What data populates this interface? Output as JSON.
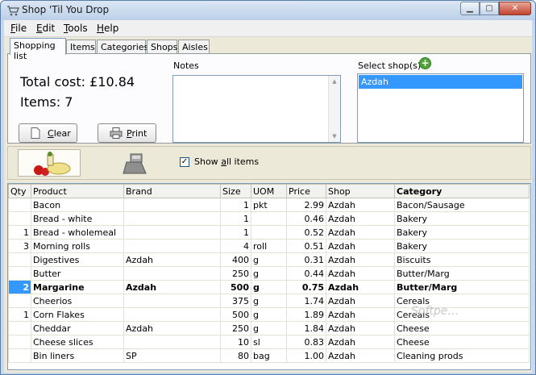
{
  "window": {
    "title": "Shop 'Til You Drop"
  },
  "menu": {
    "file": "File",
    "edit": "Edit",
    "tools": "Tools",
    "help": "Help"
  },
  "tabs": [
    "Shopping list",
    "Items",
    "Categories",
    "Shops",
    "Aisles"
  ],
  "summary": {
    "total": "Total cost: £10.84",
    "items": "Items: 7"
  },
  "buttons": {
    "clear": "Clear",
    "print": "Print"
  },
  "notes": {
    "label": "Notes",
    "value": ""
  },
  "shops": {
    "label": "Select shop(s)",
    "selected": "Azdah"
  },
  "toolbar": {
    "show_all_label": "Show all items",
    "show_all_checked": true
  },
  "grid": {
    "columns": [
      "Qty",
      "Product",
      "Brand",
      "Size",
      "UOM",
      "Price",
      "Shop",
      "Category"
    ],
    "rows": [
      [
        "",
        "Bacon",
        "",
        "1",
        "pkt",
        "2.99",
        "Azdah",
        "Bacon/Sausage"
      ],
      [
        "",
        "Bread - white",
        "",
        "1",
        "",
        "0.46",
        "Azdah",
        "Bakery"
      ],
      [
        "1",
        "Bread - wholemeal",
        "",
        "1",
        "",
        "0.52",
        "Azdah",
        "Bakery"
      ],
      [
        "3",
        "Morning rolls",
        "",
        "4",
        "roll",
        "0.51",
        "Azdah",
        "Bakery"
      ],
      [
        "",
        "Digestives",
        "Azdah",
        "400",
        "g",
        "0.31",
        "Azdah",
        "Biscuits"
      ],
      [
        "",
        "Butter",
        "",
        "250",
        "g",
        "0.44",
        "Azdah",
        "Butter/Marg"
      ],
      [
        "2",
        "Margarine",
        "Azdah",
        "500",
        "g",
        "0.75",
        "Azdah",
        "Butter/Marg"
      ],
      [
        "",
        "Cheerios",
        "",
        "375",
        "g",
        "1.74",
        "Azdah",
        "Cereals"
      ],
      [
        "1",
        "Corn Flakes",
        "",
        "500",
        "g",
        "1.89",
        "Azdah",
        "Cereals"
      ],
      [
        "",
        "Cheddar",
        "Azdah",
        "250",
        "g",
        "1.84",
        "Azdah",
        "Cheese"
      ],
      [
        "",
        "Cheese slices",
        "",
        "10",
        "sl",
        "0.83",
        "Azdah",
        "Cheese"
      ],
      [
        "",
        "Bin liners",
        "SP",
        "80",
        "bag",
        "1.00",
        "Azdah",
        "Cleaning prods"
      ]
    ],
    "current_row": 6
  }
}
